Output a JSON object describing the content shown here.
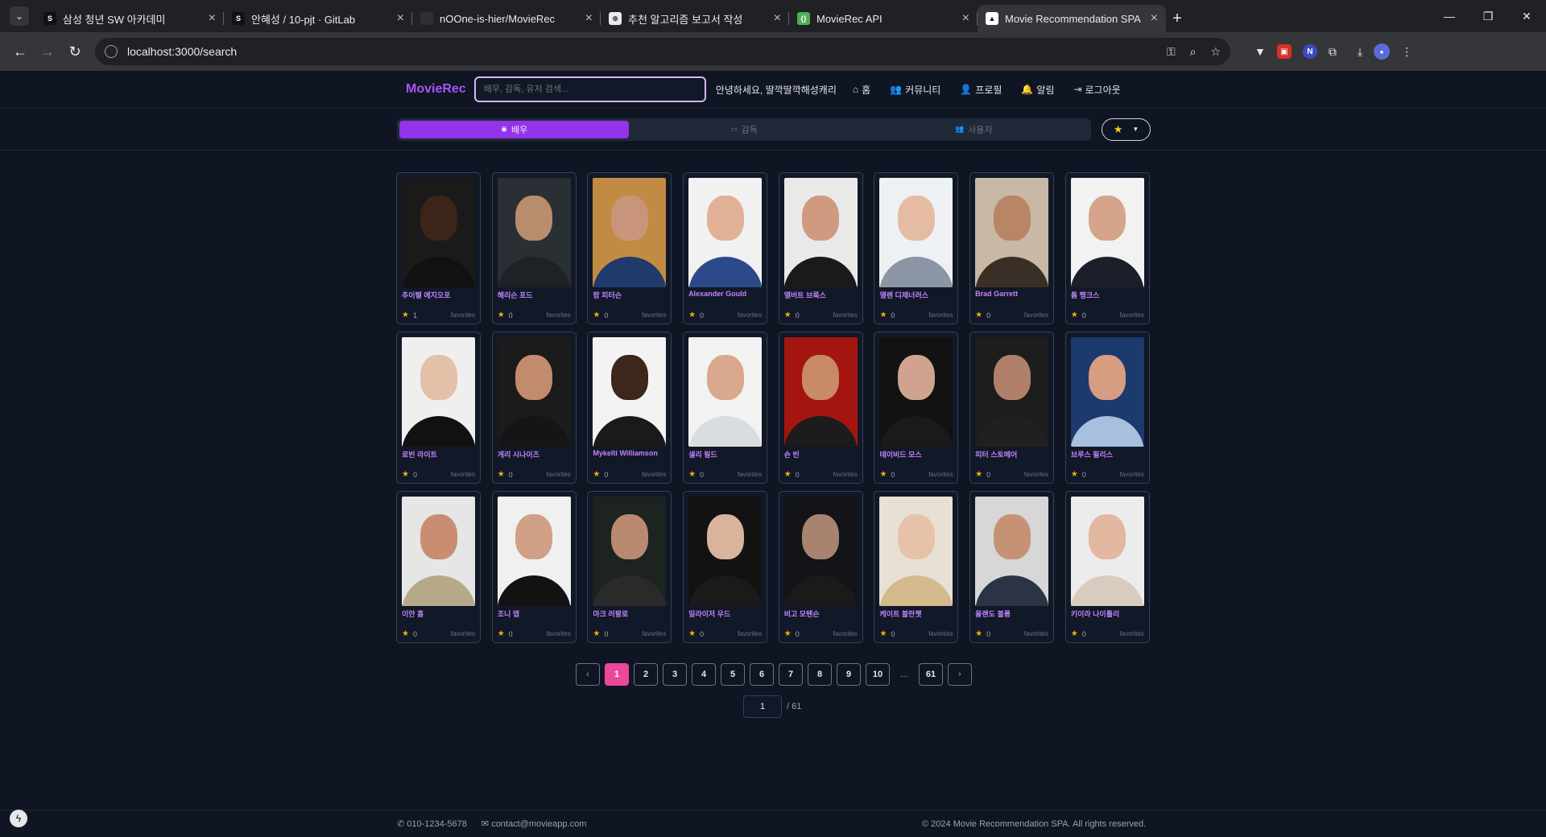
{
  "browser": {
    "tabs": [
      {
        "title": "삼성 청년 SW 아카데미",
        "favicon_color": "#111111",
        "favicon_text": "S",
        "active": false
      },
      {
        "title": "안혜성 / 10-pjt · GitLab",
        "favicon_color": "#111111",
        "favicon_text": "S",
        "active": false
      },
      {
        "title": "nOOne-is-hier/MovieRec",
        "favicon_color": "#2d2f34",
        "favicon_text": "",
        "active": false
      },
      {
        "title": "추천 알고리즘 보고서 작성",
        "favicon_color": "#e8eaed",
        "favicon_text": "⊕",
        "active": false
      },
      {
        "title": "MovieRec API",
        "favicon_color": "#4caf50",
        "favicon_text": "{}",
        "active": false
      },
      {
        "title": "Movie Recommendation SPA",
        "favicon_color": "#ffffff",
        "favicon_text": "▲",
        "active": true
      }
    ],
    "url": "localhost:3000/search"
  },
  "app": {
    "brand": "MovieRec",
    "search_placeholder": "배우, 감독, 유저 검색...",
    "greeting": "안녕하세요, 딸깍딸깍해성캐리",
    "nav": [
      {
        "label": "홈",
        "icon": "home-icon",
        "glyph": "⌂"
      },
      {
        "label": "커뮤니티",
        "icon": "users-icon",
        "glyph": "👥"
      },
      {
        "label": "프로필",
        "icon": "user-icon",
        "glyph": "👤"
      },
      {
        "label": "알림",
        "icon": "bell-icon",
        "glyph": "🔔"
      },
      {
        "label": "로그아웃",
        "icon": "logout-icon",
        "glyph": "⇥"
      }
    ],
    "segments": [
      {
        "label": "배우",
        "icon": "actor-icon",
        "glyph": "◉",
        "active": true
      },
      {
        "label": "감독",
        "icon": "camera-icon",
        "glyph": "▭",
        "active": false
      },
      {
        "label": "사용자",
        "icon": "users-icon",
        "glyph": "👥",
        "active": false
      }
    ],
    "fav_filter_star": "★",
    "fav_word": "favorites",
    "people": [
      {
        "name": "추이텔 에지오포",
        "count": "1",
        "bg": "#1a1a1a",
        "skin": "#3b2418",
        "shirt": "#111111"
      },
      {
        "name": "해리슨 포드",
        "count": "0",
        "bg": "#2a2f33",
        "skin": "#b88d6d",
        "shirt": "#1e2226"
      },
      {
        "name": "팜 피터슨",
        "count": "0",
        "bg": "#c28b43",
        "skin": "#c9957a",
        "shirt": "#1f3a6b"
      },
      {
        "name": "Alexander Gould",
        "count": "0",
        "bg": "#f1f1f1",
        "skin": "#e1b195",
        "shirt": "#2c4a8a"
      },
      {
        "name": "앨버트 브룩스",
        "count": "0",
        "bg": "#e9e9e9",
        "skin": "#cf9a80",
        "shirt": "#1a1a1a"
      },
      {
        "name": "엘렌 디제너러스",
        "count": "0",
        "bg": "#eef1f4",
        "skin": "#e5bba3",
        "shirt": "#8c95a3"
      },
      {
        "name": "Brad Garrett",
        "count": "0",
        "bg": "#c8b8a5",
        "skin": "#b88566",
        "shirt": "#3a2f26"
      },
      {
        "name": "톰 행크스",
        "count": "0",
        "bg": "#f2f2f2",
        "skin": "#d6a48a",
        "shirt": "#1b1f2a"
      },
      {
        "name": "로빈 라이트",
        "count": "0",
        "bg": "#efefef",
        "skin": "#e3c0a8",
        "shirt": "#111111"
      },
      {
        "name": "게리 시나이즈",
        "count": "0",
        "bg": "#1b1b1b",
        "skin": "#c38b6d",
        "shirt": "#151515"
      },
      {
        "name": "Mykelti Williamson",
        "count": "0",
        "bg": "#f3f3f3",
        "skin": "#3d261b",
        "shirt": "#1a1a1a"
      },
      {
        "name": "샐리 필드",
        "count": "0",
        "bg": "#f2f2f2",
        "skin": "#d9a88d",
        "shirt": "#d8dde2"
      },
      {
        "name": "숀 빈",
        "count": "0",
        "bg": "#a5150f",
        "skin": "#c98a68",
        "shirt": "#1c1c1c"
      },
      {
        "name": "데이비드 모스",
        "count": "0",
        "bg": "#121212",
        "skin": "#cfa390",
        "shirt": "#1a1a1a"
      },
      {
        "name": "피터 스토메어",
        "count": "0",
        "bg": "#1d1d1d",
        "skin": "#b0806a",
        "shirt": "#202020"
      },
      {
        "name": "브루스 윌리스",
        "count": "0",
        "bg": "#1c3a6e",
        "skin": "#d69d83",
        "shirt": "#a8c0dd"
      },
      {
        "name": "이안 홈",
        "count": "0",
        "bg": "#e6e6e6",
        "skin": "#c98e72",
        "shirt": "#b7a889"
      },
      {
        "name": "조니 뎁",
        "count": "0",
        "bg": "#f0f0f0",
        "skin": "#cfa085",
        "shirt": "#121212"
      },
      {
        "name": "마크 러팔로",
        "count": "0",
        "bg": "#1d2320",
        "skin": "#b98a70",
        "shirt": "#2a2a2a"
      },
      {
        "name": "일라이저 우드",
        "count": "0",
        "bg": "#121212",
        "skin": "#d9b39c",
        "shirt": "#1a1a1a"
      },
      {
        "name": "비고 모텐슨",
        "count": "0",
        "bg": "#121418",
        "skin": "#a88470",
        "shirt": "#1a1a1a"
      },
      {
        "name": "케이트 블란쳇",
        "count": "0",
        "bg": "#e8e0d4",
        "skin": "#e6c3a8",
        "shirt": "#d4b98c"
      },
      {
        "name": "올랜도 블룸",
        "count": "0",
        "bg": "#d7d7d7",
        "skin": "#c59276",
        "shirt": "#2a3444"
      },
      {
        "name": "키이라 나이틀리",
        "count": "0",
        "bg": "#ececec",
        "skin": "#e2b8a0",
        "shirt": "#d8ccbf"
      }
    ],
    "pagination": {
      "prev": "‹",
      "pages": [
        "1",
        "2",
        "3",
        "4",
        "5",
        "6",
        "7",
        "8",
        "9",
        "10"
      ],
      "ellipsis": "...",
      "last": "61",
      "next": "›",
      "current": "1",
      "total_label": "/ 61"
    },
    "footer": {
      "phone": "010-1234-5678",
      "email": "contact@movieapp.com",
      "copyright": "© 2024 Movie Recommendation SPA. All rights reserved."
    }
  }
}
